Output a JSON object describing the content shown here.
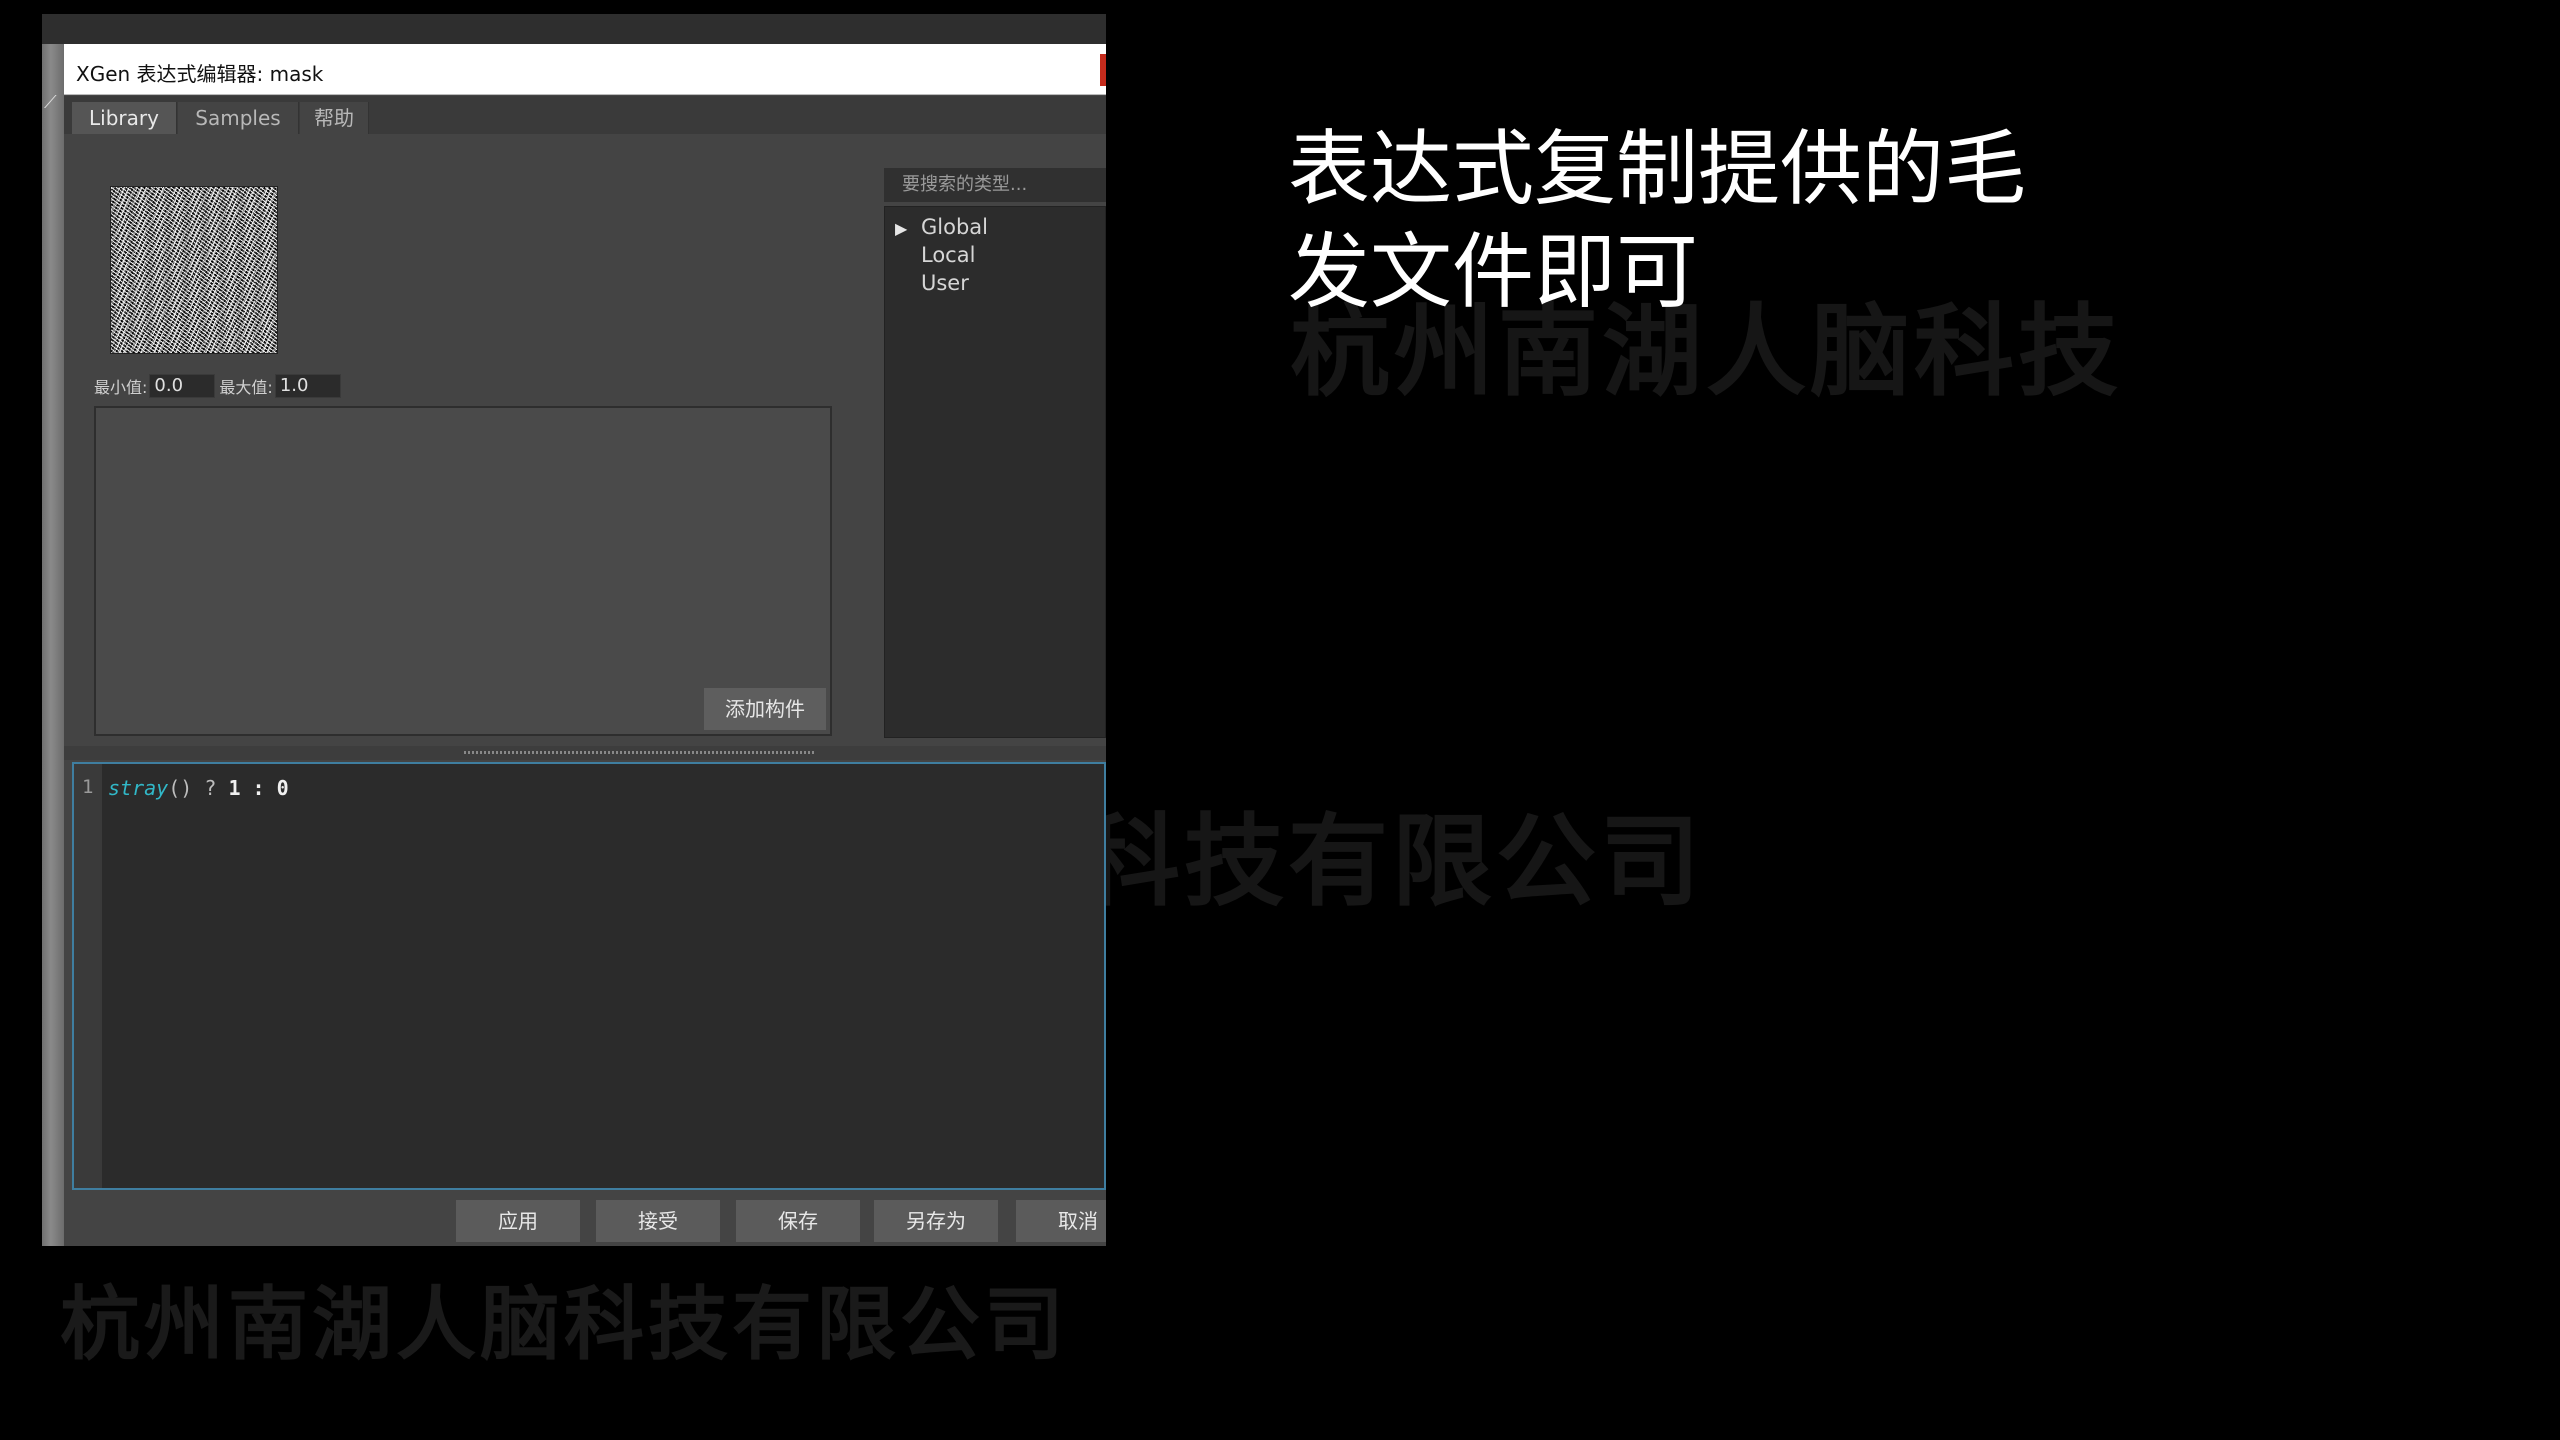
{
  "window": {
    "title": "XGen 表达式编辑器: mask"
  },
  "tabs": [
    {
      "label": "Library",
      "active": true
    },
    {
      "label": "Samples",
      "active": false
    },
    {
      "label": "帮助",
      "active": false
    }
  ],
  "library": {
    "min_label": "最小值:",
    "min_value": "0.0",
    "max_label": "最大值:",
    "max_value": "1.0",
    "add_widget_label": "添加构件",
    "search_placeholder": "要搜索的类型...",
    "tree": [
      {
        "label": "Global",
        "expandable": true
      },
      {
        "label": "Local",
        "expandable": false
      },
      {
        "label": "User",
        "expandable": false
      }
    ]
  },
  "editor": {
    "line_number": "1",
    "code": {
      "fn": "stray",
      "parens": "()",
      "q": " ? ",
      "a": "1",
      "sep": " : ",
      "b": "0"
    }
  },
  "buttons": {
    "apply": "应用",
    "accept": "接受",
    "save": "保存",
    "save_as": "另存为",
    "cancel": "取消"
  },
  "caption": {
    "line1": "表达式复制提供的毛",
    "line2": "发文件即可"
  },
  "colors": {
    "background": "#000000",
    "panel": "#444444",
    "editor_bg": "#2b2b2b",
    "editor_border": "#3f7ea0",
    "code_function": "#31b8c8",
    "close_accent": "#c42b1c"
  }
}
